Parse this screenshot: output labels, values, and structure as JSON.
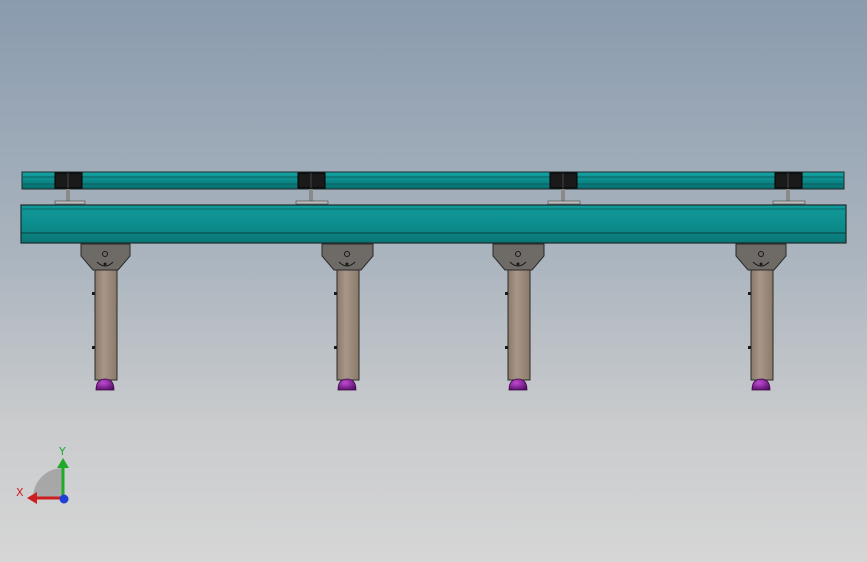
{
  "view": {
    "triad": {
      "x_label": "X",
      "y_label": "Y",
      "x_color": "#cc1f1f",
      "y_color": "#1faa2a",
      "z_color": "#1f3fd6"
    }
  },
  "model": {
    "conveyor_color": "#0c8a8a",
    "leg_color": "#9c8a78",
    "bracket_color": "#6e6b66",
    "foot_color": "#8a1a9e",
    "leg_count": 4,
    "slider_count": 4
  }
}
